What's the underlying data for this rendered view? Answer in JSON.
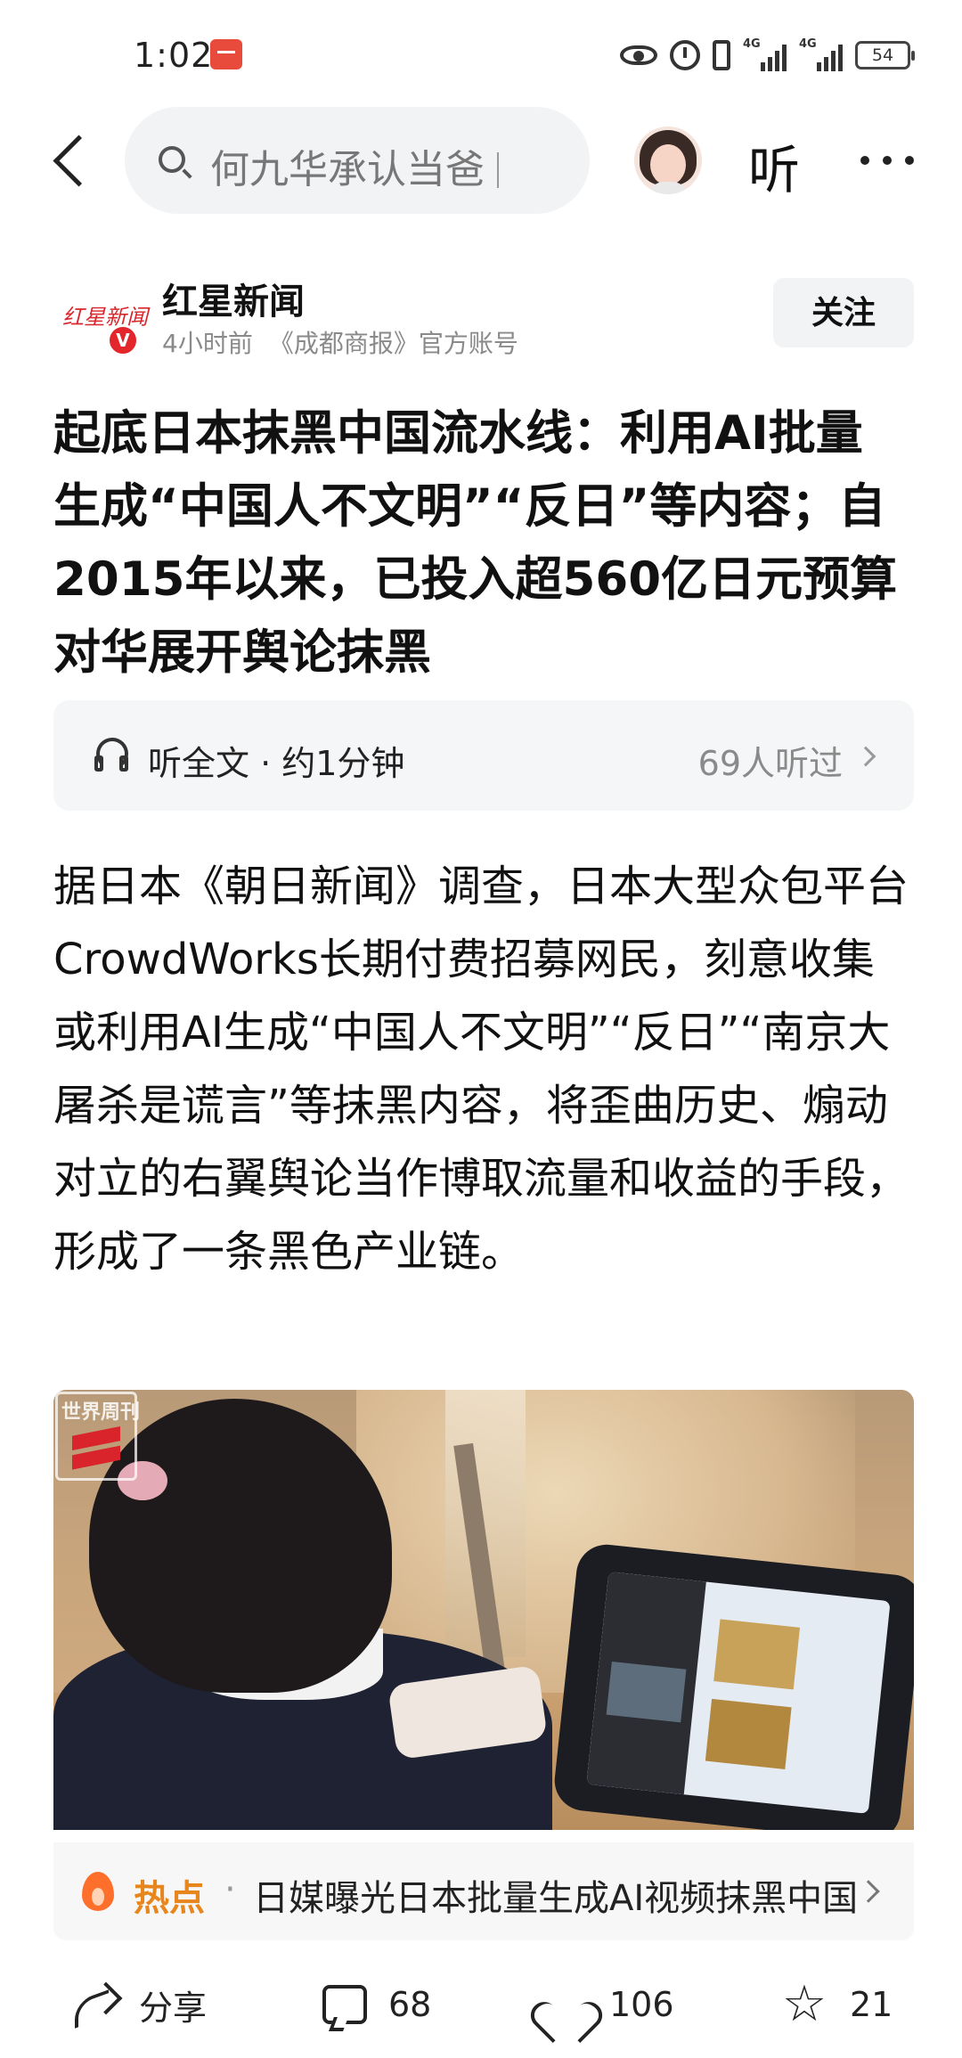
{
  "status_bar": {
    "time": "1:02",
    "battery": "54",
    "network_label": "4G"
  },
  "search": {
    "query": "何九华承认当爸"
  },
  "header": {
    "listen_label": "听"
  },
  "author": {
    "logo_text": "红星新闻",
    "name": "红星新闻",
    "time": "4小时前",
    "source": "《成都商报》官方账号",
    "verified_mark": "V",
    "follow_label": "关注"
  },
  "article": {
    "title": "起底日本抹黑中国流水线：利用AI批量生成“中国人不文明”“反日”等内容；自2015年以来，已投入超560亿日元预算对华展开舆论抹黑",
    "listen": {
      "label": "听全文 · 约1分钟",
      "listeners": "69人听过"
    },
    "body": "据日本《朝日新闻》调查，日本大型众包平台CrowdWorks长期付费招募网民，刻意收集或利用AI生成“中国人不文明”“反日”“南京大屠杀是谎言”等抹黑内容，将歪曲历史、煽动对立的右翼舆论当作博取流量和收益的手段，形成了一条黑色产业链。",
    "image_watermark": "世界周刊"
  },
  "hot_topic": {
    "label": "热点",
    "separator": "·",
    "text": "日媒曝光日本批量生成AI视频抹黑中国"
  },
  "actions": {
    "share_label": "分享",
    "comments": "68",
    "likes": "106",
    "favorites": "21"
  },
  "colors": {
    "brand_red": "#d8262b",
    "hot_orange": "#e8861e",
    "flame": "#ff6f2c",
    "panel_bg": "#f5f6f7"
  },
  "icons": [
    "eye-icon",
    "alarm-icon",
    "vibrate-icon",
    "signal-icon",
    "battery-icon",
    "back-icon",
    "search-icon",
    "more-icon",
    "headphone-icon",
    "chevron-right-icon",
    "flame-icon",
    "share-icon",
    "comment-icon",
    "heart-icon",
    "star-icon"
  ]
}
